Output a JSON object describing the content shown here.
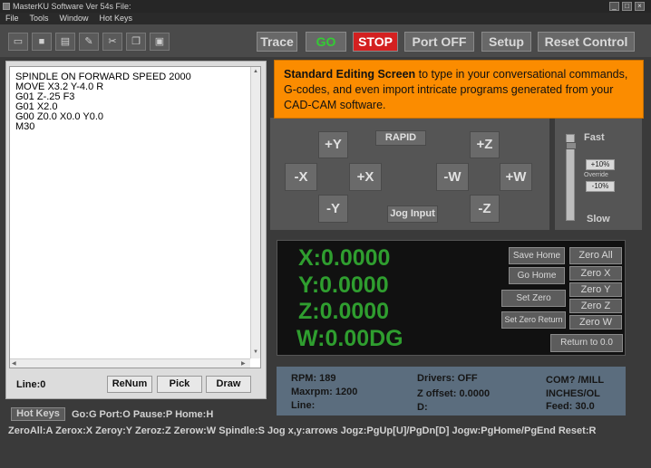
{
  "window": {
    "title": "MasterKU Software Ver 54s File:"
  },
  "menu": [
    "File",
    "Tools",
    "Window",
    "Hot Keys"
  ],
  "toolbar": {
    "icons": [
      "open-folder-icon",
      "save-disk-icon",
      "print-icon",
      "edit-pencil-icon",
      "cut-scissors-icon",
      "copy-icon",
      "paste-icon"
    ],
    "buttons": {
      "trace": "Trace",
      "go": "GO",
      "stop": "STOP",
      "port_off": "Port OFF",
      "setup": "Setup",
      "reset_control": "Reset Control"
    }
  },
  "editor": {
    "lines": "SPINDLE ON FORWARD SPEED 2000\nMOVE X3.2 Y-4.0 R\nG01 Z-.25 F3\nG01 X2.0\nG00 Z0.0 X0.0 Y0.0\nM30",
    "line_label": "Line:0",
    "renum": "ReNum",
    "pick": "Pick",
    "draw": "Draw"
  },
  "callout": {
    "bold": "Standard Editing Screen",
    "text": " to type in your conversational commands, G-codes, and even import intricate programs generated from your CAD-CAM software."
  },
  "jog": {
    "plus_y": "+Y",
    "minus_x": "-X",
    "plus_x": "+X",
    "minus_y": "-Y",
    "rapid": "RAPID",
    "jog_input": "Jog Input",
    "plus_z": "+Z",
    "minus_w": "-W",
    "plus_w": "+W",
    "minus_z": "-Z"
  },
  "speed": {
    "fast": "Fast",
    "plus10": "+10%",
    "override": "Override",
    "minus10": "-10%",
    "slow": "Slow"
  },
  "dro": {
    "x": "X:0.0000",
    "y": "Y:0.0000",
    "z": "Z:0.0000",
    "w": "W:0.00DG"
  },
  "dro_buttons": {
    "save_home": "Save Home",
    "go_home": "Go Home",
    "set_zero": "Set Zero",
    "set_zero_return": "Set Zero Return",
    "zero_all": "Zero All",
    "zero_x": "Zero X",
    "zero_y": "Zero Y",
    "zero_z": "Zero Z",
    "zero_w": "Zero W",
    "return_to_zero": "Return to 0.0"
  },
  "status": {
    "rpm": "RPM: 189",
    "maxrpm": "Maxrpm: 1200",
    "line": "Line:",
    "drivers": "Drivers: OFF",
    "z_offset": "Z offset: 0.0000",
    "d": "D:",
    "com": "COM? /MILL",
    "units": "INCHES/OL",
    "feed": "Feed: 30.0"
  },
  "hotkeys": {
    "button": "Hot Keys",
    "row1": "Go:G  Port:O  Pause:P  Home:H",
    "row2": "ZeroAll:A  Zerox:X  Zeroy:Y  Zeroz:Z  Zerow:W  Spindle:S  Jog x,y:arrows  Jogz:PgUp[U]/PgDn[D]  Jogw:PgHome/PgEnd  Reset:R"
  },
  "colors": {
    "go": "#33cc33",
    "stop_bg": "#d42020",
    "dro_green": "#2f9e2f",
    "callout": "#fb8c00"
  }
}
